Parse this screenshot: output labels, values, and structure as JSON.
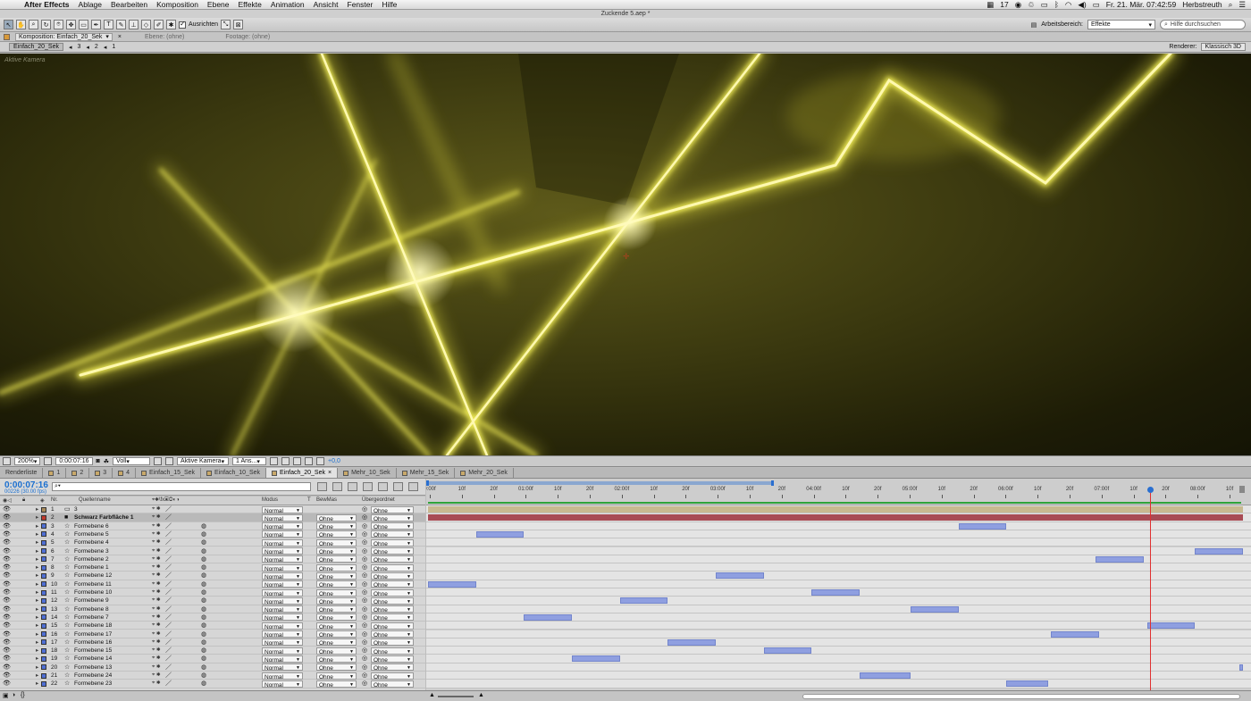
{
  "menubar": {
    "app_name": "After Effects",
    "items": [
      "Ablage",
      "Bearbeiten",
      "Komposition",
      "Ebene",
      "Effekte",
      "Animation",
      "Ansicht",
      "Fenster",
      "Hilfe"
    ],
    "status_number": "17",
    "datetime": "Fr. 21. Mär. 07:42:59",
    "user": "Herbstreuth"
  },
  "window_title": "Zuckende 5.aep *",
  "toolbar": {
    "snap_label": "Ausrichten",
    "workspace_label": "Arbeitsbereich:",
    "workspace_value": "Effekte",
    "search_placeholder": "Hilfe durchsuchen"
  },
  "viewer_header": {
    "comp_tab": "Komposition: Einfach_20_Sek",
    "layer_tab": "Ebene: (ohne)",
    "footage_tab": "Footage: (ohne)",
    "breadcrumb_tab": "Einfach_20_Sek",
    "nav_numbers": [
      "3",
      "2",
      "1"
    ],
    "renderer_label": "Renderer:",
    "renderer_value": "Klassisch 3D"
  },
  "viewer": {
    "camera_label": "Aktive Kamera"
  },
  "viewer_footer": {
    "zoom": "200%",
    "timecode": "0:00:07:16",
    "resolution": "Voll",
    "camera": "Aktive Kamera",
    "views": "1 Ans...",
    "exposure": "+0,0"
  },
  "timeline_tabs": [
    {
      "label": "Renderliste",
      "active": false
    },
    {
      "label": "1",
      "active": false
    },
    {
      "label": "2",
      "active": false
    },
    {
      "label": "3",
      "active": false
    },
    {
      "label": "4",
      "active": false
    },
    {
      "label": "Einfach_15_Sek",
      "active": false
    },
    {
      "label": "Einfach_10_Sek",
      "active": false
    },
    {
      "label": "Einfach_20_Sek",
      "active": true
    },
    {
      "label": "Mehr_10_Sek",
      "active": false
    },
    {
      "label": "Mehr_15_Sek",
      "active": false
    },
    {
      "label": "Mehr_20_Sek",
      "active": false
    }
  ],
  "timeline": {
    "timecode": "0:00:07:16",
    "frames": "00226 (30.00 fps)",
    "search_value": "",
    "columns": {
      "nr": "Nr.",
      "source": "Quellenname",
      "mode": "Modus",
      "t": "T",
      "trkmat": "BewMas",
      "parent": "Übergeordnet"
    },
    "ruler_labels": [
      "0:00f",
      "10f",
      "20f",
      "01:00f",
      "10f",
      "20f",
      "02:00f",
      "10f",
      "20f",
      "03:00f",
      "10f",
      "20f",
      "04:00f",
      "10f",
      "20f",
      "05:00f",
      "10f",
      "20f",
      "06:00f",
      "10f",
      "20f",
      "07:00f",
      "10f",
      "20f",
      "08:00f",
      "10f"
    ],
    "cti_frame": 226,
    "total_frames": 255,
    "layers": [
      {
        "nr": "1",
        "name": "3",
        "type": "camera",
        "color": "#a88a5a",
        "mode": "Normal",
        "trkmat": "",
        "parent": "Ohne",
        "bar_start": 0,
        "bar_end": 255,
        "bar_color": "#c8b990"
      },
      {
        "nr": "2",
        "name": "Schwarz Farbfläche 1",
        "type": "solid",
        "color": "#c0392b",
        "mode": "Normal",
        "trkmat": "Ohne",
        "parent": "Ohne",
        "bar_start": 0,
        "bar_end": 255,
        "bar_color": "#a84b54",
        "selected": true
      },
      {
        "nr": "3",
        "name": "Formebene 6",
        "type": "shape",
        "color": "#4f6fd4",
        "mode": "Normal",
        "trkmat": "Ohne",
        "parent": "Ohne",
        "bar_start": 166,
        "bar_end": 181
      },
      {
        "nr": "4",
        "name": "Formebene 5",
        "type": "shape",
        "color": "#4f6fd4",
        "mode": "Normal",
        "trkmat": "Ohne",
        "parent": "Ohne",
        "bar_start": 15,
        "bar_end": 30
      },
      {
        "nr": "5",
        "name": "Formebene 4",
        "type": "shape",
        "color": "#4f6fd4",
        "mode": "Normal",
        "trkmat": "Ohne",
        "parent": "Ohne",
        "bar_start": -1,
        "bar_end": -1
      },
      {
        "nr": "6",
        "name": "Formebene 3",
        "type": "shape",
        "color": "#4f6fd4",
        "mode": "Normal",
        "trkmat": "Ohne",
        "parent": "Ohne",
        "bar_start": 240,
        "bar_end": 255
      },
      {
        "nr": "7",
        "name": "Formebene 2",
        "type": "shape",
        "color": "#4f6fd4",
        "mode": "Normal",
        "trkmat": "Ohne",
        "parent": "Ohne",
        "bar_start": 209,
        "bar_end": 224
      },
      {
        "nr": "8",
        "name": "Formebene 1",
        "type": "shape",
        "color": "#4f6fd4",
        "mode": "Normal",
        "trkmat": "Ohne",
        "parent": "Ohne",
        "bar_start": -1,
        "bar_end": -1
      },
      {
        "nr": "9",
        "name": "Formebene 12",
        "type": "shape",
        "color": "#4f6fd4",
        "mode": "Normal",
        "trkmat": "Ohne",
        "parent": "Ohne",
        "bar_start": 90,
        "bar_end": 105
      },
      {
        "nr": "10",
        "name": "Formebene 11",
        "type": "shape",
        "color": "#4f6fd4",
        "mode": "Normal",
        "trkmat": "Ohne",
        "parent": "Ohne",
        "bar_start": 0,
        "bar_end": 15
      },
      {
        "nr": "11",
        "name": "Formebene 10",
        "type": "shape",
        "color": "#4f6fd4",
        "mode": "Normal",
        "trkmat": "Ohne",
        "parent": "Ohne",
        "bar_start": 120,
        "bar_end": 135
      },
      {
        "nr": "12",
        "name": "Formebene 9",
        "type": "shape",
        "color": "#4f6fd4",
        "mode": "Normal",
        "trkmat": "Ohne",
        "parent": "Ohne",
        "bar_start": 60,
        "bar_end": 75
      },
      {
        "nr": "13",
        "name": "Formebene 8",
        "type": "shape",
        "color": "#4f6fd4",
        "mode": "Normal",
        "trkmat": "Ohne",
        "parent": "Ohne",
        "bar_start": 151,
        "bar_end": 166
      },
      {
        "nr": "14",
        "name": "Formebene 7",
        "type": "shape",
        "color": "#4f6fd4",
        "mode": "Normal",
        "trkmat": "Ohne",
        "parent": "Ohne",
        "bar_start": 30,
        "bar_end": 45
      },
      {
        "nr": "15",
        "name": "Formebene 18",
        "type": "shape",
        "color": "#4f6fd4",
        "mode": "Normal",
        "trkmat": "Ohne",
        "parent": "Ohne",
        "bar_start": 225,
        "bar_end": 240
      },
      {
        "nr": "16",
        "name": "Formebene 17",
        "type": "shape",
        "color": "#4f6fd4",
        "mode": "Normal",
        "trkmat": "Ohne",
        "parent": "Ohne",
        "bar_start": 195,
        "bar_end": 210
      },
      {
        "nr": "17",
        "name": "Formebene 16",
        "type": "shape",
        "color": "#4f6fd4",
        "mode": "Normal",
        "trkmat": "Ohne",
        "parent": "Ohne",
        "bar_start": 75,
        "bar_end": 90
      },
      {
        "nr": "18",
        "name": "Formebene 15",
        "type": "shape",
        "color": "#4f6fd4",
        "mode": "Normal",
        "trkmat": "Ohne",
        "parent": "Ohne",
        "bar_start": 105,
        "bar_end": 120
      },
      {
        "nr": "19",
        "name": "Formebene 14",
        "type": "shape",
        "color": "#4f6fd4",
        "mode": "Normal",
        "trkmat": "Ohne",
        "parent": "Ohne",
        "bar_start": 45,
        "bar_end": 60
      },
      {
        "nr": "20",
        "name": "Formebene 13",
        "type": "shape",
        "color": "#4f6fd4",
        "mode": "Normal",
        "trkmat": "Ohne",
        "parent": "Ohne",
        "bar_start": 254,
        "bar_end": 255
      },
      {
        "nr": "21",
        "name": "Formebene 24",
        "type": "shape",
        "color": "#4f6fd4",
        "mode": "Normal",
        "trkmat": "Ohne",
        "parent": "Ohne",
        "bar_start": 135,
        "bar_end": 151
      },
      {
        "nr": "22",
        "name": "Formebene 23",
        "type": "shape",
        "color": "#4f6fd4",
        "mode": "Normal",
        "trkmat": "Ohne",
        "parent": "Ohne",
        "bar_start": 181,
        "bar_end": 194
      }
    ]
  },
  "colors": {
    "accent": "#1a6fd0",
    "cti": "#e03030",
    "layer_bar": "#8f9fe0",
    "glow": "#f4f060"
  }
}
